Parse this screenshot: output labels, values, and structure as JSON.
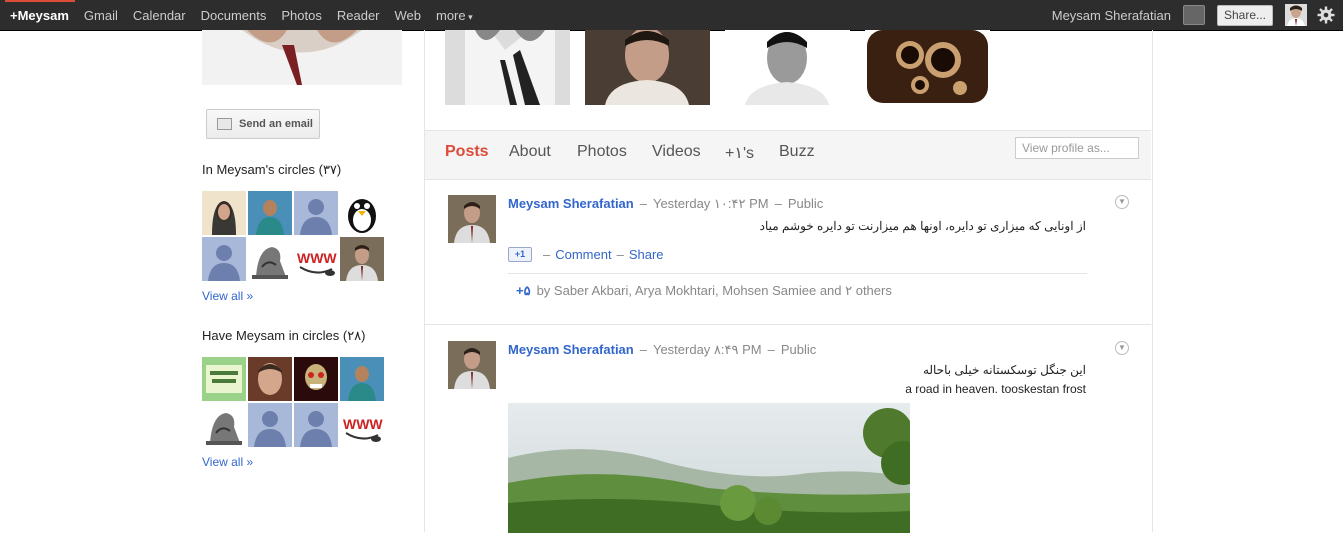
{
  "topbar": {
    "brand": "+Meysam",
    "nav": [
      "Gmail",
      "Calendar",
      "Documents",
      "Photos",
      "Reader",
      "Web",
      "more"
    ],
    "user_name": "Meysam Sherafatian",
    "share_label": "Share...",
    "icons": [
      "notification-icon",
      "avatar",
      "gear-icon"
    ]
  },
  "left": {
    "send_email_label": "Send an email",
    "in_circles_title": "In Meysam's circles (۳۷)",
    "have_circles_title": "Have Meysam in circles (۲۸)",
    "view_all": "View all »"
  },
  "tabs": {
    "items": [
      "Posts",
      "About",
      "Photos",
      "Videos",
      "+۱'s",
      "Buzz"
    ],
    "active": "Posts",
    "view_profile_placeholder": "View profile as..."
  },
  "posts": [
    {
      "author": "Meysam Sherafatian",
      "time": "Yesterday ۱۰:۴۲ PM",
      "visibility": "Public",
      "text": "از اونایی که میزاری تو دایره، اونها هم میزارنت تو دایره خوشم میاد",
      "actions": {
        "plus": "+1",
        "comment": "Comment",
        "share": "Share"
      },
      "plus_count": "+۵",
      "plus_by": "by Saber Akbari, Arya Mokhtari, Mohsen Samiee and ۲ others"
    },
    {
      "author": "Meysam Sherafatian",
      "time": "Yesterday ۸:۴۹ PM",
      "visibility": "Public",
      "text_rtl": "این جنگل توسکستانه خیلی باحاله",
      "text_ltr": "a road in heaven. tooskestan frost"
    }
  ],
  "colors": {
    "topbar": "#2d2d2d",
    "accent_red": "#dd4b39",
    "link_blue": "#3366cc"
  }
}
